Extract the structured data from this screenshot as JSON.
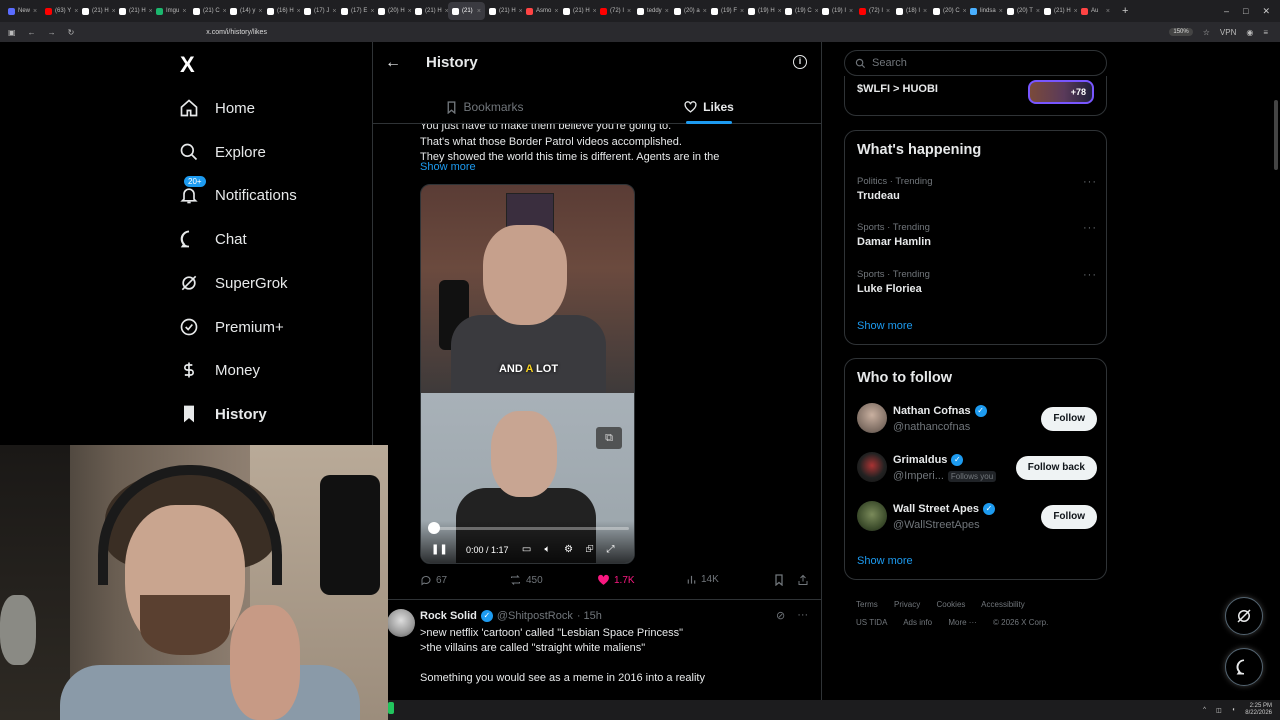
{
  "browser": {
    "tabs": [
      {
        "label": "New",
        "color": "#5a6cff"
      },
      {
        "label": "(63) Y",
        "color": "#ff0000"
      },
      {
        "label": "(21) H",
        "color": "#ffffff"
      },
      {
        "label": "(21) H",
        "color": "#ffffff"
      },
      {
        "label": "Imgu",
        "color": "#1bb76e"
      },
      {
        "label": "(21) C",
        "color": "#ffffff"
      },
      {
        "label": "(14) y",
        "color": "#ffffff"
      },
      {
        "label": "(16) H",
        "color": "#ffffff"
      },
      {
        "label": "(17) J",
        "color": "#ffffff"
      },
      {
        "label": "(17) E",
        "color": "#ffffff"
      },
      {
        "label": "(20) H",
        "color": "#ffffff"
      },
      {
        "label": "(21) H",
        "color": "#ffffff"
      },
      {
        "label": "(21)",
        "color": "#ffffff",
        "active": true
      },
      {
        "label": "(21) H",
        "color": "#ffffff"
      },
      {
        "label": "Asmo",
        "color": "#ff4444"
      },
      {
        "label": "(21) H",
        "color": "#ffffff"
      },
      {
        "label": "(72) I",
        "color": "#ff0000"
      },
      {
        "label": "teddy",
        "color": "#ffffff"
      },
      {
        "label": "(20) a",
        "color": "#ffffff"
      },
      {
        "label": "(19) F",
        "color": "#ffffff"
      },
      {
        "label": "(19) H",
        "color": "#ffffff"
      },
      {
        "label": "(19) C",
        "color": "#ffffff"
      },
      {
        "label": "(19) I",
        "color": "#ffffff"
      },
      {
        "label": "(72) I",
        "color": "#ff0000"
      },
      {
        "label": "(18) I",
        "color": "#ffffff"
      },
      {
        "label": "(20) C",
        "color": "#ffffff"
      },
      {
        "label": "lindsa",
        "color": "#4ab0ff"
      },
      {
        "label": "(20) T",
        "color": "#ffffff"
      },
      {
        "label": "(21) H",
        "color": "#ffffff"
      },
      {
        "label": "Au",
        "color": "#ff4444"
      }
    ],
    "url": "x.com/i/history/likes",
    "zoom": "150%",
    "vpn_label": "VPN"
  },
  "nav": {
    "logo": "X",
    "items": [
      {
        "label": "Home",
        "icon": "home-icon"
      },
      {
        "label": "Explore",
        "icon": "search-icon"
      },
      {
        "label": "Notifications",
        "icon": "bell-icon",
        "badge": "20+"
      },
      {
        "label": "Chat",
        "icon": "chat-icon"
      },
      {
        "label": "SuperGrok",
        "icon": "grok-icon"
      },
      {
        "label": "Premium+",
        "icon": "verified-icon"
      },
      {
        "label": "Money",
        "icon": "dollar-icon"
      },
      {
        "label": "History",
        "icon": "bookmark-icon",
        "active": true
      }
    ]
  },
  "header": {
    "title": "History",
    "tabs": [
      {
        "label": "Bookmarks",
        "active": false
      },
      {
        "label": "Likes",
        "active": true
      }
    ]
  },
  "tweet1": {
    "lines": [
      "You just have to make them believe you're going to.",
      "That's what those Border Patrol videos accomplished.",
      "They showed the world this time is different. Agents are in the"
    ],
    "show_more": "Show more",
    "video": {
      "caption_plain1": "AND ",
      "caption_highlight": "A",
      "caption_plain2": " LOT",
      "time": "0:00 / 1:17",
      "progress": 0.02
    },
    "stats": {
      "replies": "67",
      "reposts": "450",
      "likes": "1.7K",
      "views": "14K"
    }
  },
  "tweet2": {
    "name": "Rock Solid",
    "handle": "@ShitpostRock",
    "time": "· 15h",
    "lines": [
      ">new netflix 'cartoon' called \"Lesbian Space Princess\"",
      ">the villains are called \"straight white maliens\"",
      "",
      "Something you would see as a meme in 2016 into a reality"
    ]
  },
  "right": {
    "search_placeholder": "Search",
    "promo": {
      "text": "$WLFI > HUOBI",
      "count": "+78"
    },
    "happening": {
      "title": "What's happening",
      "trends": [
        {
          "category": "Politics · Trending",
          "name": "Trudeau"
        },
        {
          "category": "Sports · Trending",
          "name": "Damar Hamlin"
        },
        {
          "category": "Sports · Trending",
          "name": "Luke Floriea"
        }
      ],
      "show_more": "Show more"
    },
    "who_to_follow": {
      "title": "Who to follow",
      "users": [
        {
          "name": "Nathan Cofnas",
          "handle": "@nathancofnas",
          "button": "Follow",
          "follows_you": ""
        },
        {
          "name": "Grimaldus",
          "handle": "@Imperi...",
          "button": "Follow back",
          "follows_you": "Follows you"
        },
        {
          "name": "Wall Street Apes",
          "handle": "@WallStreetApes",
          "button": "Follow",
          "follows_you": ""
        }
      ],
      "show_more": "Show more"
    },
    "footer": {
      "row1": [
        "Terms",
        "Privacy",
        "Cookies",
        "Accessibility"
      ],
      "row2": [
        "US TIDA",
        "Ads info",
        "More ···",
        "© 2026 X Corp."
      ]
    }
  },
  "taskbar": {
    "time": "2:25 PM",
    "date": "8/22/2026"
  }
}
